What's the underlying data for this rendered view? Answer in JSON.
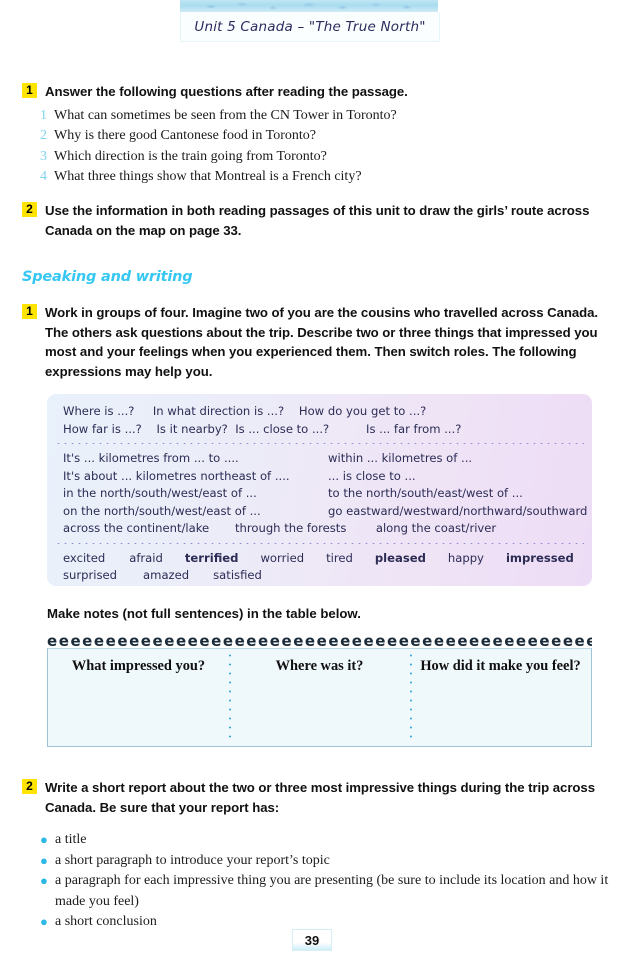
{
  "header": {
    "unit_title": "Unit 5  Canada – \"The True North\""
  },
  "reading_exercise_1": {
    "number": "1",
    "instruction": "Answer the following questions after reading the passage.",
    "questions": [
      {
        "num": "1",
        "text": "What can sometimes be seen from the CN Tower in Toronto?"
      },
      {
        "num": "2",
        "text": "Why is there good Cantonese food in Toronto?"
      },
      {
        "num": "3",
        "text": "Which direction is the train going from Toronto?"
      },
      {
        "num": "4",
        "text": "What three things show that Montreal is a French city?"
      }
    ]
  },
  "reading_exercise_2": {
    "number": "2",
    "instruction": "Use the information in both reading passages of this unit to draw the girls’ route across Canada on the map on page 33."
  },
  "speaking_section": {
    "heading": "Speaking and writing",
    "exercise_1": {
      "number": "1",
      "instruction": "Work in groups of four. Imagine two of you are the cousins who travelled across Canada. The others ask questions about the trip. Describe two or three things that impressed you most and your feelings when you experienced them. Then switch roles. The following expressions may help you."
    }
  },
  "phrase_box": {
    "questions": [
      "Where is ...?     In what direction is ...?    How do you get to ...?",
      "How far is ...?    Is it nearby?  Is ... close to ...?          Is ... far from ...?"
    ],
    "expressions": {
      "left_column": [
        "It's ... kilometres from ... to ....",
        "It's about ... kilometres northeast of ....",
        "in the north/south/west/east of ...",
        "on the north/south/west/east of ..."
      ],
      "right_column": [
        "within ... kilometres of ...",
        "... is close to ...",
        "to the north/south/east/west of ...",
        "go eastward/westward/northward/southward"
      ],
      "last_line": "across the continent/lake       through the forests        along the coast/river"
    },
    "adjectives_row_1": [
      {
        "word": "excited",
        "bold": false
      },
      {
        "word": "afraid",
        "bold": false
      },
      {
        "word": "terrified",
        "bold": true
      },
      {
        "word": "worried",
        "bold": false
      },
      {
        "word": "tired",
        "bold": false
      },
      {
        "word": "pleased",
        "bold": true
      },
      {
        "word": "happy",
        "bold": false
      },
      {
        "word": "impressed",
        "bold": true
      }
    ],
    "adjectives_row_2": [
      {
        "word": "surprised",
        "bold": false
      },
      {
        "word": "amazed",
        "bold": false
      },
      {
        "word": "satisfied",
        "bold": false
      }
    ]
  },
  "notes": {
    "instruction": "Make notes (not full sentences) in the table below.",
    "spiral_glyphs": "eeeeeeeeeeeeeeeeeeeeeeeeeeeeeeeeeeeeeeeeeeeeeeeeeeeeeeeeeeee",
    "columns": [
      "What impressed you?",
      "Where was it?",
      "How did it make you feel?"
    ]
  },
  "writing_exercise_2": {
    "number": "2",
    "instruction": "Write a short report about the two or three most impressive things during the trip across Canada. Be sure that your report has:",
    "bullets": [
      "a title",
      "a short paragraph to introduce your report’s topic",
      "a paragraph for each impressive thing you are presenting (be sure to include its location and how it made you feel)",
      "a short conclusion"
    ],
    "bullet_glyph": "●"
  },
  "footer": {
    "page_number": "39"
  },
  "colors": {
    "badge_yellow": "#ffe400",
    "accent_cyan": "#36c7f2",
    "bullet_cyan": "#2eb8e6",
    "question_number_cyan": "#7fd3ee"
  }
}
